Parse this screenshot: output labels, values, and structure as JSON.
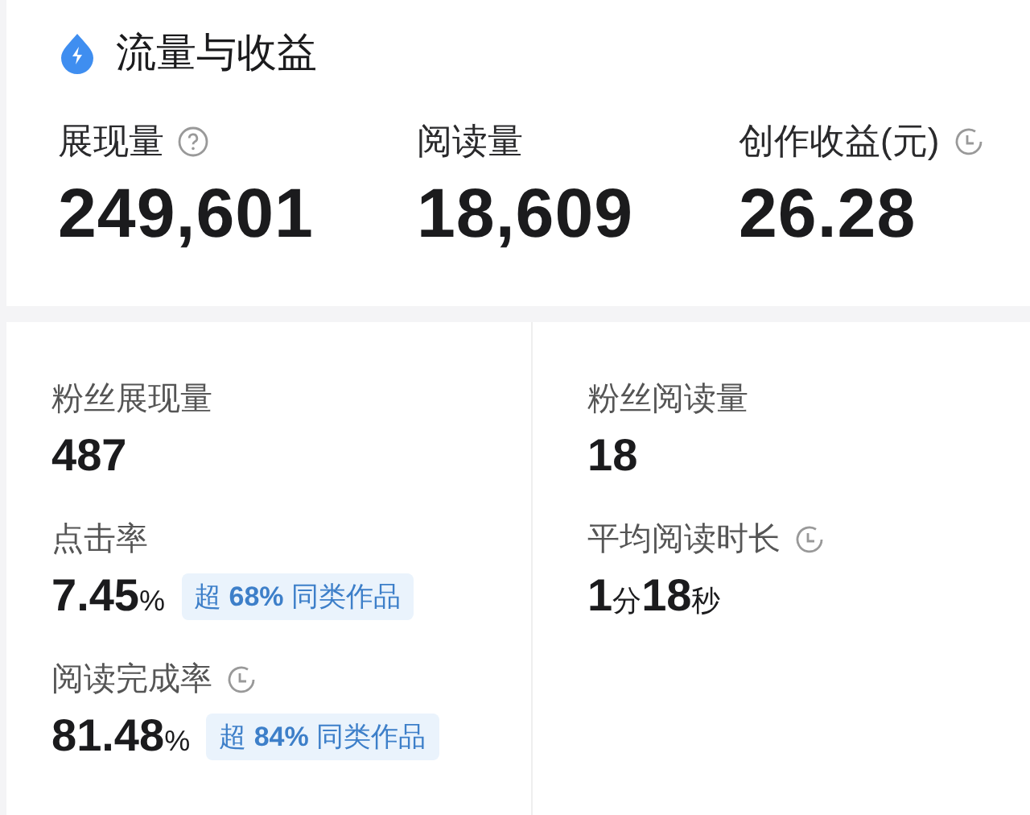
{
  "header": {
    "title": "流量与收益"
  },
  "summary": [
    {
      "label": "展现量",
      "kind": "help",
      "value": "249,601"
    },
    {
      "label": "阅读量",
      "kind": "plain",
      "value": "18,609"
    },
    {
      "label": "创作收益(元)",
      "kind": "timed",
      "value": "26.28"
    }
  ],
  "columns": [
    {
      "metrics": [
        {
          "label": "粉丝展现量",
          "kind": "plain",
          "value": [
            {
              "text": "487",
              "kind": "number"
            }
          ]
        },
        {
          "label": "点击率",
          "kind": "plain",
          "value": [
            {
              "text": "7.45",
              "kind": "number"
            },
            {
              "text": "%",
              "kind": "unit"
            }
          ],
          "badge": "超 **68%** 同类作品"
        },
        {
          "label": "阅读完成率",
          "kind": "timed",
          "value": [
            {
              "text": "81.48",
              "kind": "number"
            },
            {
              "text": "%",
              "kind": "unit"
            }
          ],
          "badge": "超 **84%** 同类作品"
        }
      ]
    },
    {
      "metrics": [
        {
          "label": "粉丝阅读量",
          "kind": "plain",
          "value": [
            {
              "text": "18",
              "kind": "number"
            }
          ]
        },
        {
          "label": "平均阅读时长",
          "kind": "timed",
          "value": [
            {
              "text": "1",
              "kind": "number"
            },
            {
              "text": "分",
              "kind": "unit"
            },
            {
              "text": "18",
              "kind": "number"
            },
            {
              "text": "秒",
              "kind": "unit"
            }
          ]
        }
      ]
    }
  ]
}
